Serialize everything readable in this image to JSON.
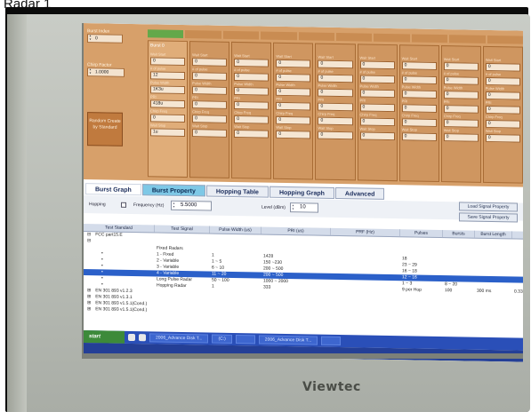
{
  "caption": "Radar 1",
  "brand": "Viewtec",
  "left_panel": {
    "burst_index_label": "Burst Index",
    "burst_index_value": "0",
    "chirp_factor_label": "Chirp Factor",
    "chirp_factor_value": "1.0000",
    "random_button": "Random Create by Standard"
  },
  "burst_column_headers": [
    "",
    "",
    "",
    "",
    "",
    "",
    "",
    "",
    "",
    ""
  ],
  "bursts": [
    {
      "title": "Burst 0",
      "fields": [
        {
          "label": "Wait Start",
          "value": "0"
        },
        {
          "label": "# of pulse",
          "value": "12"
        },
        {
          "label": "Pulse Width",
          "value": "1K3u"
        },
        {
          "label": "PRI",
          "value": "418u"
        },
        {
          "label": "Chirp Freq",
          "value": "0"
        },
        {
          "label": "Wait Stop",
          "value": "1u"
        }
      ]
    },
    {
      "title": "",
      "fields": [
        {
          "label": "Wait Start",
          "value": "0"
        },
        {
          "label": "# of pulse",
          "value": "0"
        },
        {
          "label": "Pulse Width",
          "value": "0"
        },
        {
          "label": "PRI",
          "value": "0"
        },
        {
          "label": "Chirp Freq",
          "value": "0"
        },
        {
          "label": "Wait Stop",
          "value": "0"
        }
      ]
    },
    {
      "title": "",
      "fields": [
        {
          "label": "Wait Start",
          "value": "0"
        },
        {
          "label": "# of pulse",
          "value": "0"
        },
        {
          "label": "Pulse Width",
          "value": "0"
        },
        {
          "label": "PRI",
          "value": "0"
        },
        {
          "label": "Chirp Freq",
          "value": "0"
        },
        {
          "label": "Wait Stop",
          "value": "0"
        }
      ]
    },
    {
      "title": "",
      "fields": [
        {
          "label": "Wait Start",
          "value": "0"
        },
        {
          "label": "# of pulse",
          "value": "0"
        },
        {
          "label": "Pulse Width",
          "value": "0"
        },
        {
          "label": "PRI",
          "value": "0"
        },
        {
          "label": "Chirp Freq",
          "value": "0"
        },
        {
          "label": "Wait Stop",
          "value": "0"
        }
      ]
    },
    {
      "title": "",
      "fields": [
        {
          "label": "Wait Start",
          "value": "0"
        },
        {
          "label": "# of pulse",
          "value": "0"
        },
        {
          "label": "Pulse Width",
          "value": "0"
        },
        {
          "label": "PRI",
          "value": "0"
        },
        {
          "label": "Chirp Freq",
          "value": "0"
        },
        {
          "label": "Wait Stop",
          "value": "0"
        }
      ]
    },
    {
      "title": "",
      "fields": [
        {
          "label": "Wait Start",
          "value": "0"
        },
        {
          "label": "# of pulse",
          "value": "0"
        },
        {
          "label": "Pulse Width",
          "value": "0"
        },
        {
          "label": "PRI",
          "value": "0"
        },
        {
          "label": "Chirp Freq",
          "value": "0"
        },
        {
          "label": "Wait Stop",
          "value": "0"
        }
      ]
    },
    {
      "title": "",
      "fields": [
        {
          "label": "Wait Start",
          "value": "0"
        },
        {
          "label": "# of pulse",
          "value": "0"
        },
        {
          "label": "Pulse Width",
          "value": "0"
        },
        {
          "label": "PRI",
          "value": "0"
        },
        {
          "label": "Chirp Freq",
          "value": "0"
        },
        {
          "label": "Wait Stop",
          "value": "0"
        }
      ]
    },
    {
      "title": "",
      "fields": [
        {
          "label": "Wait Start",
          "value": "0"
        },
        {
          "label": "# of pulse",
          "value": "0"
        },
        {
          "label": "Pulse Width",
          "value": "0"
        },
        {
          "label": "PRI",
          "value": "0"
        },
        {
          "label": "Chirp Freq",
          "value": "0"
        },
        {
          "label": "Wait Stop",
          "value": "0"
        }
      ]
    },
    {
      "title": "",
      "fields": [
        {
          "label": "Wait Start",
          "value": "0"
        },
        {
          "label": "# of pulse",
          "value": "0"
        },
        {
          "label": "Pulse Width",
          "value": "0"
        },
        {
          "label": "PRI",
          "value": "0"
        },
        {
          "label": "Chirp Freq",
          "value": "0"
        },
        {
          "label": "Wait Stop",
          "value": "0"
        }
      ]
    }
  ],
  "tabs": [
    "Burst Graph",
    "Burst Property",
    "Hopping Table",
    "Hopping Graph",
    "Advanced"
  ],
  "controls": {
    "hopping_label": "Hopping",
    "frequency_label": "Frequency (Hz)",
    "frequency_value": "5.5000",
    "level_label": "Level (dBm)",
    "level_value": "10",
    "load_button": "Load Signal Property",
    "save_button": "Save Signal Property"
  },
  "table": {
    "headers": [
      "Test Standard",
      "Test Signal",
      "Pulse Width (us)",
      "PRI (us)",
      "PRF (Hz)",
      "Pulses",
      "Bursts",
      "Burst Length",
      ""
    ],
    "rows": [
      {
        "tree": "⊟",
        "cells": [
          "FCC part15.E",
          "",
          "",
          "",
          "",
          "",
          "",
          "",
          ""
        ],
        "selected": false
      },
      {
        "tree": "⊟",
        "cells": [
          "",
          "",
          "",
          "",
          "",
          "",
          "",
          "",
          ""
        ],
        "selected": false
      },
      {
        "tree": "",
        "cells": [
          "",
          "Fixed Radars",
          "",
          "",
          "",
          "",
          "",
          "",
          ""
        ],
        "selected": false
      },
      {
        "tree": "•",
        "cells": [
          "",
          "1 - Fixed",
          "1",
          "1428",
          "",
          "18",
          "",
          "",
          ""
        ],
        "selected": false
      },
      {
        "tree": "•",
        "cells": [
          "",
          "2 - Variable",
          "1 ~ 5",
          "150 ~230",
          "",
          "23 ~ 29",
          "",
          "",
          ""
        ],
        "selected": false
      },
      {
        "tree": "•",
        "cells": [
          "",
          "3 - Variable",
          "6 ~ 10",
          "200 ~ 500",
          "",
          "16 ~ 18",
          "",
          "",
          ""
        ],
        "selected": false
      },
      {
        "tree": "•",
        "cells": [
          "",
          "4 - Variable",
          "11 ~ 20",
          "200 ~ 500",
          "",
          "12 ~ 16",
          "",
          "",
          ""
        ],
        "selected": true
      },
      {
        "tree": "•",
        "cells": [
          "",
          "Long Pulse Radar",
          "50 ~ 100",
          "1000 ~ 2000",
          "",
          "1 ~ 3",
          "8 ~ 20",
          "",
          ""
        ],
        "selected": false
      },
      {
        "tree": "•",
        "cells": [
          "",
          "Hopping Radar",
          "1",
          "333",
          "",
          "9 per Hop",
          "100",
          "300 ms",
          "0.333"
        ],
        "selected": false
      },
      {
        "tree": "⊞",
        "cells": [
          "EN 301 893 v1.2.3",
          "",
          "",
          "",
          "",
          "",
          "",
          "",
          ""
        ],
        "selected": false
      },
      {
        "tree": "⊞",
        "cells": [
          "EN 301 893 v1.3.1",
          "",
          "",
          "",
          "",
          "",
          "",
          "",
          ""
        ],
        "selected": false
      },
      {
        "tree": "⊞",
        "cells": [
          "EN 301 893 v1.5.1(Cond.)",
          "",
          "",
          "",
          "",
          "",
          "",
          "",
          ""
        ],
        "selected": false
      },
      {
        "tree": "⊞",
        "cells": [
          "EN 301 893 v1.5.1(Cond.)",
          "",
          "",
          "",
          "",
          "",
          "",
          "",
          ""
        ],
        "selected": false
      }
    ]
  },
  "taskbar": {
    "start_label": "start",
    "tasks": [
      "2006_Advance Disk T...",
      "(C:)",
      "",
      "2006_Advance Disk T...",
      ""
    ]
  }
}
